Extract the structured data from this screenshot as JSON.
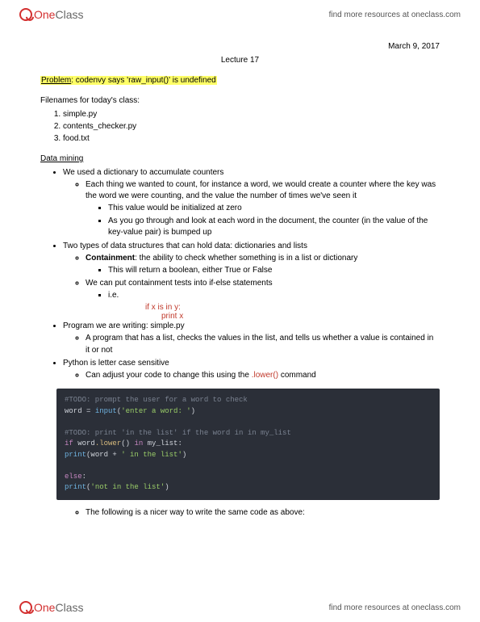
{
  "header": {
    "logo_one": "One",
    "logo_class": "Class",
    "link_text": "find more resources at oneclass.com"
  },
  "doc": {
    "date": "March 9, 2017",
    "title": "Lecture 17",
    "problem_label": "Problem",
    "problem_text": ": codenvy says 'raw_input()' is undefined",
    "filenames_label": "Filenames for today's class:",
    "files": [
      "simple.py",
      "contents_checker.py",
      "food.txt"
    ],
    "data_mining_header": "Data mining",
    "b_dict": "We used a dictionary to accumulate counters",
    "b_dict_1": "Each thing we wanted to count, for instance a word, we would create a counter where the key was the word we were counting, and the value the number of times we've seen it",
    "b_dict_1a": "This value would be initialized at zero",
    "b_dict_1b": "As you go through and look at each word in the document, the counter (in the value of the key-value pair) is bumped up",
    "b_types": "Two types of data structures that can hold data: dictionaries and lists",
    "b_contain_label": "Containment",
    "b_contain_text": ": the ability to check whether something is in a list or dictionary",
    "b_contain_1": "This will return a boolean, either True or False",
    "b_contain_tests": "We can put containment tests into if-else statements",
    "b_ie": "i.e.",
    "code_if": "if x is in y:",
    "code_print": "print x",
    "b_program": "Program we are writing: simple.py",
    "b_program_1": "A program that has a list, checks the values in the list, and tells us whether a value is contained in it or not",
    "b_python": "Python is letter case sensitive",
    "b_python_1_pre": "Can adjust your code to change this using the ",
    "b_python_1_cmd": ".lower()",
    "b_python_1_post": " command",
    "b_nicer": "The following is a nicer way to write the same code as above:",
    "codeblock": {
      "l1_comment": "#TODO: prompt the user for a word to check",
      "l2_a": "word = ",
      "l2_b": "input",
      "l2_c": "(",
      "l2_d": "'enter a word: '",
      "l2_e": ")",
      "l3_comment": "#TODO: print 'in the list' if the word in in my_list",
      "l4_a": "if",
      "l4_b": " word",
      "l4_c": ".lower",
      "l4_d": "() ",
      "l4_e": "in",
      "l4_f": " my_list:",
      "l5_a": "    print",
      "l5_b": "(word + ",
      "l5_c": "' in the list'",
      "l5_d": ")",
      "l6_a": "else",
      "l6_b": ":",
      "l7_a": "    print",
      "l7_b": "(",
      "l7_c": "'not in the list'",
      "l7_d": ")"
    }
  }
}
